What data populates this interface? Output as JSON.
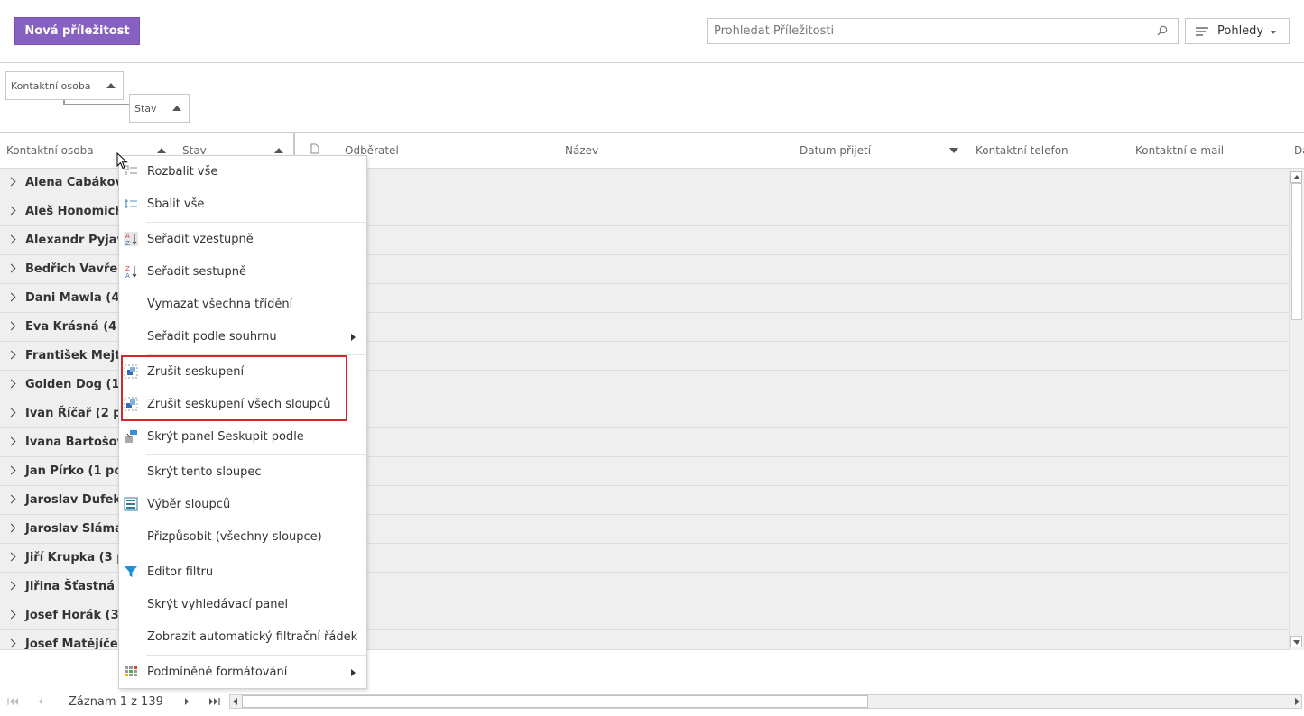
{
  "toolbar": {
    "new_button": "Nová příležitost",
    "search_placeholder": "Prohledat Příležitosti",
    "views_button": "Pohledy"
  },
  "group_panel": {
    "chips": [
      "Kontaktní osoba",
      "Stav"
    ]
  },
  "columns": {
    "group_headers": [
      "Kontaktní osoba",
      "Stav"
    ],
    "headers": [
      "Odběratel",
      "Název",
      "Datum přijetí",
      "Kontaktní telefon",
      "Kontaktní e-mail",
      "Da"
    ]
  },
  "rows": [
    "Alena Cabákov",
    "Aleš Honomich",
    "Alexandr Pyjav",
    "Bedřich Vavřen",
    "Dani Mawla (4 p",
    "Eva Krásná (4 p",
    "František Mejta",
    "Golden Dog (1",
    "Ivan Říčař (2 pc",
    "Ivana Bartošova",
    "Jan Pírko (1 po",
    "Jaroslav Dufek",
    "Jaroslav Sláma",
    "Jiří Krupka (3 p",
    "Jiřina Šťastná (4",
    "Josef Horák (3",
    "Josef Matějíček"
  ],
  "context_menu": {
    "items": [
      {
        "label": "Rozbalit vše",
        "icon": "expand-all-icon"
      },
      {
        "label": "Sbalit vše",
        "icon": "collapse-all-icon"
      },
      {
        "label": "Seřadit vzestupně",
        "icon": "sort-ascending-icon"
      },
      {
        "label": "Seřadit sestupně",
        "icon": "sort-descending-icon"
      },
      {
        "label": "Vymazat všechna třídění",
        "icon": ""
      },
      {
        "label": "Seřadit podle souhrnu",
        "icon": "",
        "submenu": true
      },
      {
        "label": "Zrušit seskupení",
        "icon": "ungroup-icon"
      },
      {
        "label": "Zrušit seskupení všech sloupců",
        "icon": "ungroup-all-icon"
      },
      {
        "label": "Skrýt panel Seskupit podle",
        "icon": "hide-group-panel-icon"
      },
      {
        "label": "Skrýt tento sloupec",
        "icon": ""
      },
      {
        "label": "Výběr sloupců",
        "icon": "column-chooser-icon"
      },
      {
        "label": "Přizpůsobit (všechny sloupce)",
        "icon": ""
      },
      {
        "label": "Editor filtru",
        "icon": "filter-icon"
      },
      {
        "label": "Skrýt vyhledávací panel",
        "icon": ""
      },
      {
        "label": "Zobrazit automatický filtrační řádek",
        "icon": ""
      },
      {
        "label": "Podmíněné formátování",
        "icon": "conditional-format-icon",
        "submenu": true
      }
    ]
  },
  "pager": {
    "record_text": "Záznam 1 z 139"
  },
  "colors": {
    "accent": "#8661c1",
    "highlight": "#d9232d",
    "row_bg": "#efefef"
  }
}
